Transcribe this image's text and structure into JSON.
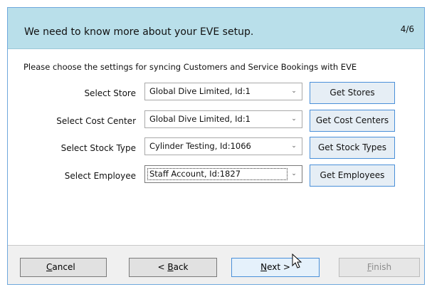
{
  "header": {
    "title": "We need to know more about your EVE setup.",
    "step": "4/6"
  },
  "intro": "Please choose the settings for syncing Customers and Service Bookings with EVE",
  "rows": [
    {
      "label": "Select Store",
      "value": "Global Dive Limited, Id:1",
      "button": "Get Stores"
    },
    {
      "label": "Select Cost Center",
      "value": "Global Dive Limited, Id:1",
      "button": "Get Cost Centers"
    },
    {
      "label": "Select Stock Type",
      "value": "Cylinder Testing, Id:1066",
      "button": "Get Stock Types"
    },
    {
      "label": "Select Employee",
      "value": "Staff Account, Id:1827",
      "button": "Get Employees"
    }
  ],
  "footer": {
    "cancel_pre": "",
    "cancel_key": "C",
    "cancel_post": "ancel",
    "back_pre": "< ",
    "back_key": "B",
    "back_post": "ack",
    "next_pre": "",
    "next_key": "N",
    "next_post": "ext >",
    "finish_pre": "",
    "finish_key": "F",
    "finish_post": "inish"
  },
  "icons": {
    "combo_arrow": "chevron-down-icon",
    "cursor": "mouse-pointer-icon"
  }
}
